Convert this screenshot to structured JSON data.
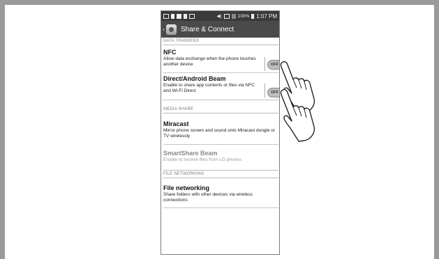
{
  "status_bar": {
    "battery_percent": "100%",
    "time": "1:07 PM"
  },
  "app_bar": {
    "title": "Share & Connect",
    "back_glyph": "‹"
  },
  "sections": {
    "data_transfer": "DATA TRANSFER",
    "media_share": "MEDIA SHARE",
    "file_networking": "FILE NETWORKING"
  },
  "items": {
    "nfc": {
      "title": "NFC",
      "description": "Allow data exchange when the phone touches another device",
      "toggle_label": "OFF",
      "enabled": false
    },
    "beam": {
      "title": "Direct/Android Beam",
      "description": "Enable to share app contents or files via NFC and Wi-Fi Direct",
      "toggle_label": "OFF",
      "enabled": false
    },
    "miracast": {
      "title": "Miracast",
      "description": "Mirror phone screen and sound onto Miracast dongle or TV wirelessly"
    },
    "smartshare": {
      "title": "SmartShare Beam",
      "description": "Enable to receive files from LG phones",
      "disabled": true
    },
    "file_networking": {
      "title": "File networking",
      "description": "Share folders with other devices via wireless connections"
    }
  },
  "icons": {
    "status_left": [
      "image-icon",
      "upload-icon",
      "calendar-icon",
      "lock-icon",
      "message-icon"
    ],
    "status_right": [
      "volume-icon",
      "nfc-status-icon",
      "signal-icon",
      "battery-icon"
    ],
    "app": "share-connect-icon",
    "overlay": [
      "hand-pointer-icon",
      "hand-pointer-icon"
    ]
  }
}
